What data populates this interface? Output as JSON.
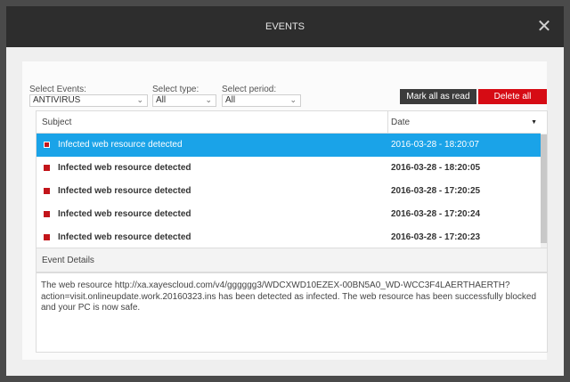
{
  "window": {
    "title": "EVENTS",
    "close_glyph": "✕"
  },
  "filters": {
    "events_label": "Select Events:",
    "events_value": "ANTIVIRUS",
    "type_label": "Select type:",
    "type_value": "All",
    "period_label": "Select period:",
    "period_value": "All",
    "chevron_icon": "chevron-down-icon"
  },
  "actions": {
    "mark_all_read": "Mark all as read",
    "delete_all": "Delete all"
  },
  "table": {
    "columns": {
      "subject": "Subject",
      "date": "Date"
    },
    "sort_caret": "▼",
    "rows": [
      {
        "subject": "Infected web resource detected",
        "date": "2016-03-28 - 18:20:07",
        "selected": true
      },
      {
        "subject": "Infected web resource detected",
        "date": "2016-03-28 - 18:20:05",
        "selected": false
      },
      {
        "subject": "Infected web resource detected",
        "date": "2016-03-28 - 17:20:25",
        "selected": false
      },
      {
        "subject": "Infected web resource detected",
        "date": "2016-03-28 - 17:20:24",
        "selected": false
      },
      {
        "subject": "Infected web resource detected",
        "date": "2016-03-28 - 17:20:23",
        "selected": false
      }
    ]
  },
  "details": {
    "heading": "Event Details",
    "text": "The web resource http://xa.xayescloud.com/v4/gggggg3/WDCXWD10EZEX-00BN5A0_WD-WCC3F4LAERTHAERTH?action=visit.onlineupdate.work.20160323.ins has been detected as infected. The web resource has been successfully blocked and your PC is now safe."
  },
  "colors": {
    "title_bar": "#2d2d2d",
    "selected_row": "#1aa3e8",
    "delete_button": "#d60b14",
    "mark_button": "#3b3b3b",
    "event_marker": "#c3151a"
  }
}
